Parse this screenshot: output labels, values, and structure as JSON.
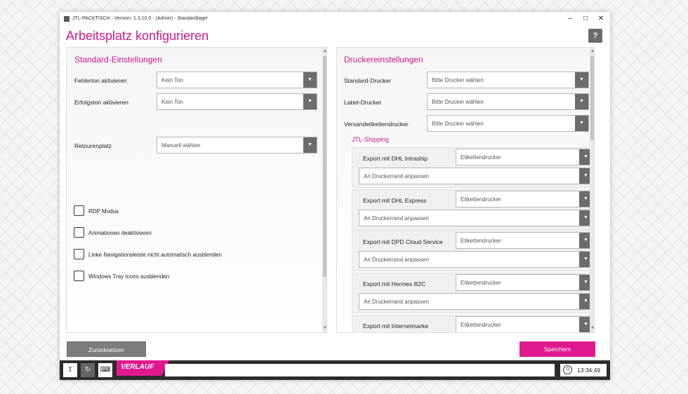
{
  "window": {
    "title": "JTL-PACKTISCH - Version: 1.3.10.0 - (Admin) - Standardlager",
    "controls": {
      "minimize": "–",
      "maximize": "□",
      "close": "✕"
    }
  },
  "page": {
    "title": "Arbeitsplatz konfigurieren",
    "help_icon": "?"
  },
  "standard": {
    "title": "Standard-Einstellungen",
    "fields": [
      {
        "label": "Fehlerton aktivieren",
        "value": "Kein Ton"
      },
      {
        "label": "Erfolgston aktivieren",
        "value": "Kein Ton"
      },
      {
        "label": "Retourenplatz",
        "value": "Manuell wählen"
      }
    ],
    "checkboxes": [
      {
        "label": "RDP Modus",
        "checked": false
      },
      {
        "label": "Animationen deaktivieren",
        "checked": false
      },
      {
        "label": "Linke Navigationsleiste nicht automatisch ausblenden",
        "checked": false
      },
      {
        "label": "Windows Tray Icons ausblenden",
        "checked": false
      }
    ]
  },
  "printer": {
    "title": "Druckereinstellungen",
    "fields": [
      {
        "label": "Standard-Drucker",
        "value": "Bitte Drucker wählen"
      },
      {
        "label": "Label-Drucker",
        "value": "Bitte Drucker wählen"
      },
      {
        "label": "Versandetikettendrucker",
        "value": "Bitte Drucker wählen"
      }
    ],
    "shipping_title": "JTL-Shipping",
    "shipping": [
      {
        "label": "Export mit DHL Intraship",
        "printer": "Etikettendrucker",
        "margin": "An Druckerrand anpassen"
      },
      {
        "label": "Export mit DHL Express",
        "printer": "Etikettendrucker",
        "margin": "An Druckerrand anpassen"
      },
      {
        "label": "Export mit DPD Cloud Service",
        "printer": "Etikettendrucker",
        "margin": "An Druckerrand anpassen"
      },
      {
        "label": "Export mit Hermes B2C",
        "printer": "Etikettendrucker",
        "margin": "An Druckerrand anpassen"
      },
      {
        "label": "Export mit Internetmarke",
        "printer": "Etikettendrucker",
        "margin": ""
      }
    ]
  },
  "actions": {
    "reset": "Zurücksetzen",
    "save": "Speichern"
  },
  "taskbar": {
    "verlauf": "VERLAUF",
    "time": "13:34:49"
  },
  "colors": {
    "accent": "#e0198f",
    "title": "#c8198c",
    "button_gray": "#7c7c7c",
    "taskbar": "#2b2b2b"
  }
}
